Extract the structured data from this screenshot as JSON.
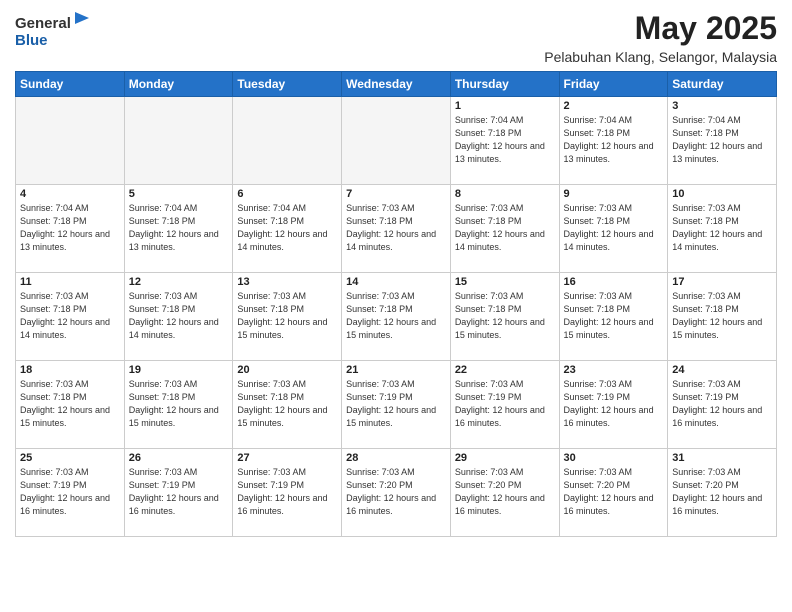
{
  "logo": {
    "general": "General",
    "blue": "Blue"
  },
  "title": "May 2025",
  "subtitle": "Pelabuhan Klang, Selangor, Malaysia",
  "days_of_week": [
    "Sunday",
    "Monday",
    "Tuesday",
    "Wednesday",
    "Thursday",
    "Friday",
    "Saturday"
  ],
  "weeks": [
    [
      {
        "day": "",
        "empty": true
      },
      {
        "day": "",
        "empty": true
      },
      {
        "day": "",
        "empty": true
      },
      {
        "day": "",
        "empty": true
      },
      {
        "day": "1",
        "sunrise": "7:04 AM",
        "sunset": "7:18 PM",
        "daylight": "12 hours and 13 minutes."
      },
      {
        "day": "2",
        "sunrise": "7:04 AM",
        "sunset": "7:18 PM",
        "daylight": "12 hours and 13 minutes."
      },
      {
        "day": "3",
        "sunrise": "7:04 AM",
        "sunset": "7:18 PM",
        "daylight": "12 hours and 13 minutes."
      }
    ],
    [
      {
        "day": "4",
        "sunrise": "7:04 AM",
        "sunset": "7:18 PM",
        "daylight": "12 hours and 13 minutes."
      },
      {
        "day": "5",
        "sunrise": "7:04 AM",
        "sunset": "7:18 PM",
        "daylight": "12 hours and 13 minutes."
      },
      {
        "day": "6",
        "sunrise": "7:04 AM",
        "sunset": "7:18 PM",
        "daylight": "12 hours and 14 minutes."
      },
      {
        "day": "7",
        "sunrise": "7:03 AM",
        "sunset": "7:18 PM",
        "daylight": "12 hours and 14 minutes."
      },
      {
        "day": "8",
        "sunrise": "7:03 AM",
        "sunset": "7:18 PM",
        "daylight": "12 hours and 14 minutes."
      },
      {
        "day": "9",
        "sunrise": "7:03 AM",
        "sunset": "7:18 PM",
        "daylight": "12 hours and 14 minutes."
      },
      {
        "day": "10",
        "sunrise": "7:03 AM",
        "sunset": "7:18 PM",
        "daylight": "12 hours and 14 minutes."
      }
    ],
    [
      {
        "day": "11",
        "sunrise": "7:03 AM",
        "sunset": "7:18 PM",
        "daylight": "12 hours and 14 minutes."
      },
      {
        "day": "12",
        "sunrise": "7:03 AM",
        "sunset": "7:18 PM",
        "daylight": "12 hours and 14 minutes."
      },
      {
        "day": "13",
        "sunrise": "7:03 AM",
        "sunset": "7:18 PM",
        "daylight": "12 hours and 15 minutes."
      },
      {
        "day": "14",
        "sunrise": "7:03 AM",
        "sunset": "7:18 PM",
        "daylight": "12 hours and 15 minutes."
      },
      {
        "day": "15",
        "sunrise": "7:03 AM",
        "sunset": "7:18 PM",
        "daylight": "12 hours and 15 minutes."
      },
      {
        "day": "16",
        "sunrise": "7:03 AM",
        "sunset": "7:18 PM",
        "daylight": "12 hours and 15 minutes."
      },
      {
        "day": "17",
        "sunrise": "7:03 AM",
        "sunset": "7:18 PM",
        "daylight": "12 hours and 15 minutes."
      }
    ],
    [
      {
        "day": "18",
        "sunrise": "7:03 AM",
        "sunset": "7:18 PM",
        "daylight": "12 hours and 15 minutes."
      },
      {
        "day": "19",
        "sunrise": "7:03 AM",
        "sunset": "7:18 PM",
        "daylight": "12 hours and 15 minutes."
      },
      {
        "day": "20",
        "sunrise": "7:03 AM",
        "sunset": "7:18 PM",
        "daylight": "12 hours and 15 minutes."
      },
      {
        "day": "21",
        "sunrise": "7:03 AM",
        "sunset": "7:19 PM",
        "daylight": "12 hours and 15 minutes."
      },
      {
        "day": "22",
        "sunrise": "7:03 AM",
        "sunset": "7:19 PM",
        "daylight": "12 hours and 16 minutes."
      },
      {
        "day": "23",
        "sunrise": "7:03 AM",
        "sunset": "7:19 PM",
        "daylight": "12 hours and 16 minutes."
      },
      {
        "day": "24",
        "sunrise": "7:03 AM",
        "sunset": "7:19 PM",
        "daylight": "12 hours and 16 minutes."
      }
    ],
    [
      {
        "day": "25",
        "sunrise": "7:03 AM",
        "sunset": "7:19 PM",
        "daylight": "12 hours and 16 minutes."
      },
      {
        "day": "26",
        "sunrise": "7:03 AM",
        "sunset": "7:19 PM",
        "daylight": "12 hours and 16 minutes."
      },
      {
        "day": "27",
        "sunrise": "7:03 AM",
        "sunset": "7:19 PM",
        "daylight": "12 hours and 16 minutes."
      },
      {
        "day": "28",
        "sunrise": "7:03 AM",
        "sunset": "7:20 PM",
        "daylight": "12 hours and 16 minutes."
      },
      {
        "day": "29",
        "sunrise": "7:03 AM",
        "sunset": "7:20 PM",
        "daylight": "12 hours and 16 minutes."
      },
      {
        "day": "30",
        "sunrise": "7:03 AM",
        "sunset": "7:20 PM",
        "daylight": "12 hours and 16 minutes."
      },
      {
        "day": "31",
        "sunrise": "7:03 AM",
        "sunset": "7:20 PM",
        "daylight": "12 hours and 16 minutes."
      }
    ]
  ]
}
